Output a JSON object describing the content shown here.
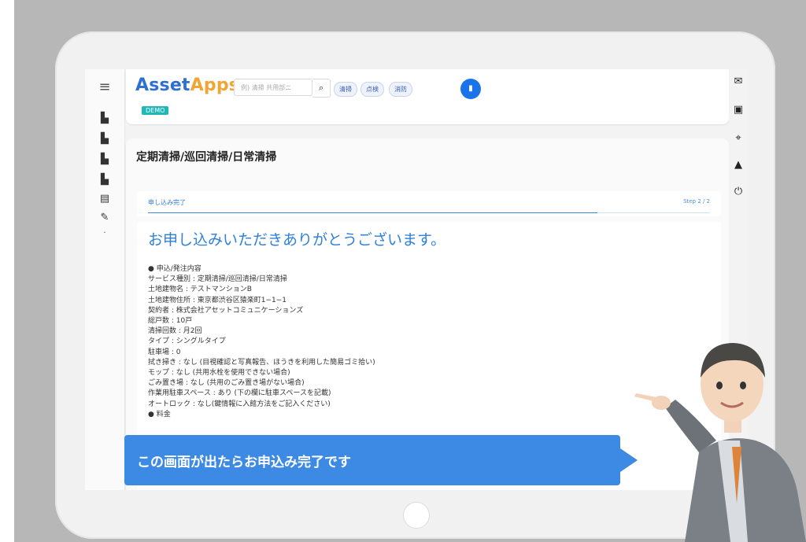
{
  "header": {
    "logo_asset": "Asset",
    "logo_apps": "Apps",
    "demo_badge": "DEMO",
    "search_placeholder": "例) 清掃 共用部ニ",
    "chips": [
      "清掃",
      "点検",
      "消防"
    ]
  },
  "sidebar": {
    "items": [
      "menu-icon",
      "building-icon",
      "building-icon",
      "building-icon",
      "building-icon",
      "box-icon",
      "wrench-icon",
      "dot-icon"
    ]
  },
  "right_rail": {
    "items": [
      "mail-icon",
      "calendar-icon",
      "map-icon",
      "drive-icon",
      "power-icon"
    ]
  },
  "main": {
    "title": "定期清掃/巡回清掃/日常清掃",
    "step": {
      "label": "申し込み完了",
      "count": "Step 2 / 2",
      "progress": 0.8
    },
    "thank_you": "お申し込みいただきありがとうございます。",
    "details": [
      "● 申込/発注内容",
      "サービス種別 : 定期清掃/巡回清掃/日常清掃",
      "土地建物名 : テストマンションB",
      "土地建物住所 : 東京都渋谷区猿楽町1−1−1",
      "契約者 : 株式会社アセットコミュニケーションズ",
      "総戸数 : 10戸",
      "清掃回数 : 月2回",
      "タイプ : シングルタイプ",
      "駐車場 : 0",
      "拭き掃き : なし (目視確認と写真報告、ほうきを利用した簡易ゴミ拾い)",
      "モップ : なし (共用水栓を使用できない場合)",
      "ごみ置き場 : なし (共用のごみ置き場がない場合)",
      "作業用駐車スペース : あり (下の欄に駐車スペースを記載)",
      "オートロック : なし(鍵情報に入館方法をご記入ください)",
      "● 料金"
    ]
  },
  "callout": {
    "text": "この画面が出たらお申込み完了です"
  },
  "colors": {
    "accent": "#3d8ae5",
    "logo_blue": "#2f6fd1",
    "logo_orange": "#f0a534",
    "demo_badge": "#1fb7b7"
  }
}
